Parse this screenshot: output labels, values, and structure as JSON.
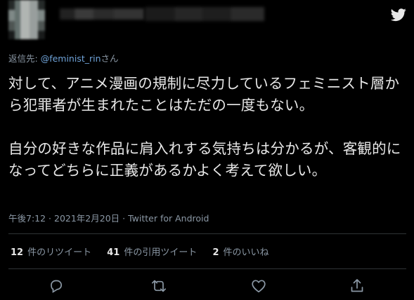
{
  "header": {
    "avatar_icon": "blurred-avatar",
    "logo_icon": "twitter-bird-icon"
  },
  "reply": {
    "prefix": "返信先: ",
    "handle": "@feminist_rin",
    "suffix": "さん"
  },
  "tweet": {
    "text": "対して、アニメ漫画の規制に尽力しているフェミニスト層から犯罪者が生まれたことはただの一度もない。\n\n自分の好きな作品に肩入れする気持ちは分かるが、客観的になってどちらに正義があるかよく考えて欲しい。"
  },
  "meta": {
    "text": "午後7:12 · 2021年2月20日 · Twitter for Android"
  },
  "stats": {
    "retweets": {
      "count": "12",
      "label": "件のリツイート"
    },
    "quotes": {
      "count": "41",
      "label": "件の引用ツイート"
    },
    "likes": {
      "count": "2",
      "label": "件のいいね"
    }
  },
  "actions": {
    "reply_icon": "reply-icon",
    "retweet_icon": "retweet-icon",
    "like_icon": "heart-icon",
    "share_icon": "share-icon"
  },
  "colors": {
    "background": "#000000",
    "text": "#e8e8e8",
    "secondary": "#8b98a5",
    "link": "#6fa3d9",
    "divider": "#2f3336"
  }
}
